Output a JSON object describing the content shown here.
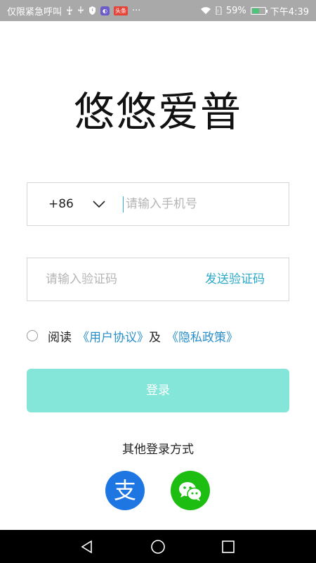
{
  "status_bar": {
    "left_text": "仅限紧急呼叫",
    "badge_app": "头条",
    "more": "···",
    "battery_percent": "59%",
    "battery_level": 0.59,
    "time": "下午4:39"
  },
  "app_title": "悠悠爱普",
  "phone_field": {
    "country_code": "+86",
    "placeholder": "请输入手机号",
    "value": ""
  },
  "code_field": {
    "placeholder": "请输入验证码",
    "value": "",
    "send_label": "发送验证码"
  },
  "agreement": {
    "checked": false,
    "read_text": "阅读",
    "user_agreement": "《用户协议》",
    "and_text": "及",
    "privacy_policy": "《隐私政策》"
  },
  "login_button": "登录",
  "other_login": {
    "title": "其他登录方式",
    "alipay_glyph": "支",
    "alipay_icon": "alipay-icon",
    "wechat_icon": "wechat-icon"
  },
  "colors": {
    "accent_link": "#2aa9c9",
    "login_button_disabled": "#84e6d9",
    "alipay_blue": "#1d76e2",
    "wechat_green": "#1ebd12"
  }
}
